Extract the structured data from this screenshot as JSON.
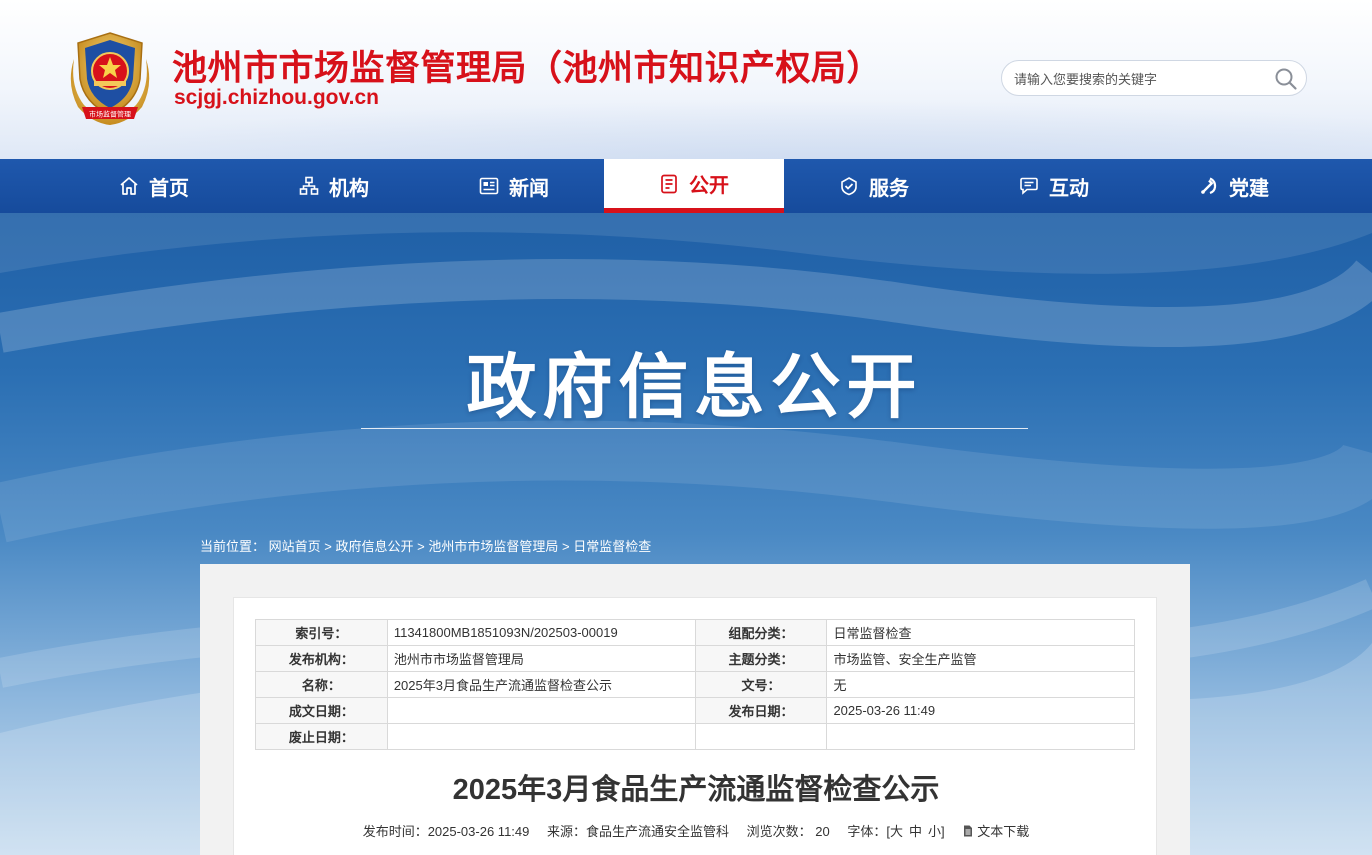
{
  "header": {
    "title": "池州市市场监督管理局（池州市知识产权局）",
    "domain": "scjgj.chizhou.gov.cn",
    "emblem_text": "市场监督管理",
    "search_placeholder": "请输入您要搜索的关键字"
  },
  "nav": {
    "items": [
      {
        "label": "首页",
        "icon": "home-icon"
      },
      {
        "label": "机构",
        "icon": "org-icon"
      },
      {
        "label": "新闻",
        "icon": "news-icon"
      },
      {
        "label": "公开",
        "icon": "open-icon",
        "active": true
      },
      {
        "label": "服务",
        "icon": "service-icon"
      },
      {
        "label": "互动",
        "icon": "chat-icon"
      },
      {
        "label": "党建",
        "icon": "party-icon"
      }
    ]
  },
  "banner": {
    "title": "政府信息公开"
  },
  "breadcrumb": {
    "prefix": "当前位置：",
    "items": [
      "网站首页",
      "政府信息公开",
      "池州市市场监督管理局",
      "日常监督检查"
    ],
    "separator": ">"
  },
  "meta_table": {
    "rows": [
      [
        "索引号：",
        "11341800MB1851093N/202503-00019",
        "组配分类：",
        "日常监督检查"
      ],
      [
        "发布机构：",
        "池州市市场监督管理局",
        "主题分类：",
        "市场监管、安全生产监管"
      ],
      [
        "名称：",
        "2025年3月食品生产流通监督检查公示",
        "文号：",
        "无"
      ],
      [
        "成文日期：",
        "",
        "发布日期：",
        "2025-03-26 11:49"
      ],
      [
        "废止日期：",
        "",
        "",
        ""
      ]
    ]
  },
  "article": {
    "title": "2025年3月食品生产流通监督检查公示",
    "publish_time": "发布时间：2025-03-26 11:49",
    "source": "来源：食品生产流通安全监管科",
    "views_label": "浏览次数：",
    "views": "20",
    "font_label": "字体：[",
    "font_large": "大",
    "font_medium": "中",
    "font_small": "小",
    "font_end": "]",
    "download": "文本下载"
  },
  "colors": {
    "brand_red": "#d7111a",
    "nav_blue": "#1f58ad"
  }
}
